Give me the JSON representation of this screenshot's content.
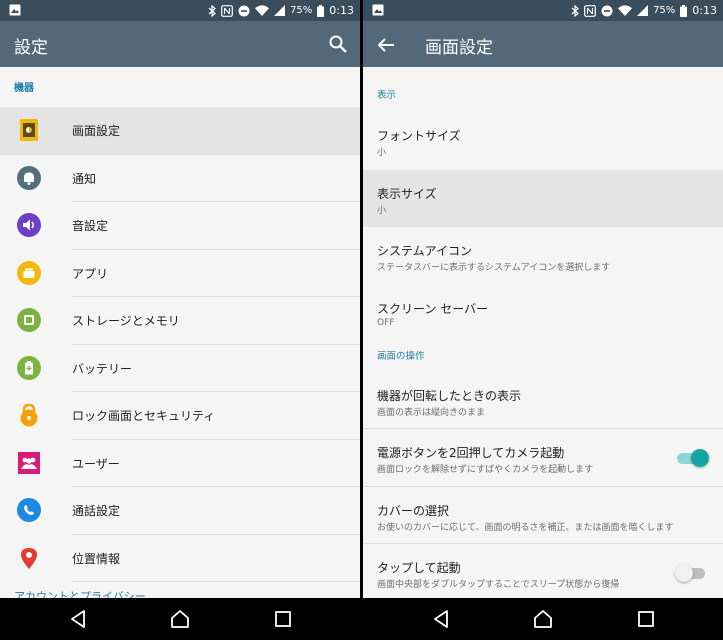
{
  "status": {
    "battery": "75%",
    "time": "0:13"
  },
  "left": {
    "title": "設定",
    "section": "機器",
    "items": [
      {
        "label": "画面設定",
        "icon": "display-icon",
        "color": "#f2b90b"
      },
      {
        "label": "通知",
        "icon": "bell-icon",
        "color": "#546e7a"
      },
      {
        "label": "音設定",
        "icon": "speaker-icon",
        "color": "#6c3fc6"
      },
      {
        "label": "アプリ",
        "icon": "apps-icon",
        "color": "#f2b90b"
      },
      {
        "label": "ストレージとメモリ",
        "icon": "storage-icon",
        "color": "#7cb342"
      },
      {
        "label": "バッテリー",
        "icon": "battery-icon",
        "color": "#7cb342"
      },
      {
        "label": "ロック画面とセキュリティ",
        "icon": "lock-icon",
        "color": "#f2a30b"
      },
      {
        "label": "ユーザー",
        "icon": "users-icon",
        "color": "#d81b7a"
      },
      {
        "label": "通話設定",
        "icon": "phone-icon",
        "color": "#1e88e5"
      },
      {
        "label": "位置情報",
        "icon": "location-icon",
        "color": "#e53935"
      }
    ],
    "cut_label": "アカウントとプライバシー"
  },
  "right": {
    "title": "画面設定",
    "section1": "表示",
    "section2": "画面の操作",
    "rows1": [
      {
        "title": "フォントサイズ",
        "sub": "小"
      },
      {
        "title": "表示サイズ",
        "sub": "小"
      },
      {
        "title": "システムアイコン",
        "sub": "ステータスバーに表示するシステムアイコンを選択します"
      },
      {
        "title": "スクリーン セーバー",
        "sub": "OFF"
      }
    ],
    "rows2": [
      {
        "title": "機器が回転したときの表示",
        "sub": "画面の表示は縦向きのまま"
      },
      {
        "title": "電源ボタンを2回押してカメラ起動",
        "sub": "画面ロックを解除せずにすばやくカメラを起動します",
        "toggle": true
      },
      {
        "title": "カバーの選択",
        "sub": "お使いのカバーに応じて、画面の明るさを補正、または画面を暗くします"
      },
      {
        "title": "タップして起動",
        "sub": "画面中央部をダブルタップすることでスリープ状態から復帰",
        "toggle": false
      }
    ]
  },
  "colors": {
    "accent": "#1e7fa6",
    "appbar": "#536878",
    "statusbar": "#3a4d5c",
    "toggle_on": "#14a5a0"
  }
}
